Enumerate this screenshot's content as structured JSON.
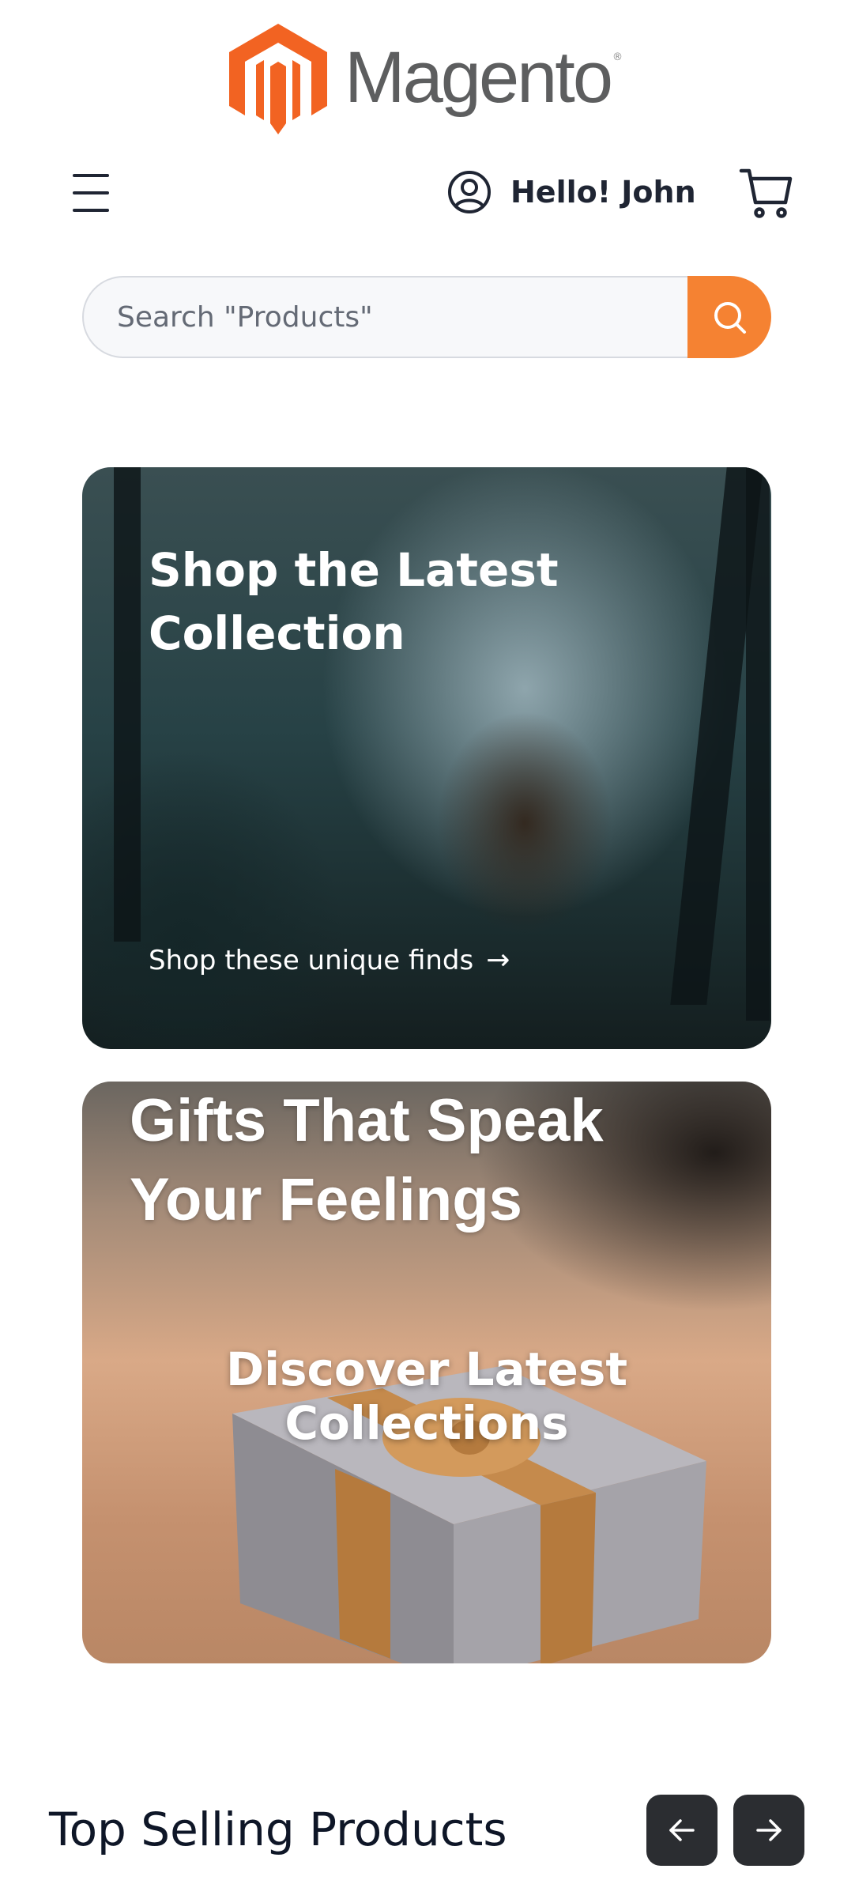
{
  "logo": {
    "name": "Magento",
    "mark": "®",
    "brand_color": "#f26322"
  },
  "header": {
    "menu_icon": "hamburger-icon",
    "user_icon": "user-circle-icon",
    "greeting": "Hello! John",
    "cart_icon": "cart-icon"
  },
  "search": {
    "placeholder": "Search \"Products\"",
    "value": "",
    "button_icon": "search-icon",
    "accent": "#f58232"
  },
  "banners": [
    {
      "title": "Shop the Latest Collection",
      "link_text": "Shop these unique finds",
      "link_icon": "arrow-right-icon"
    },
    {
      "image_text": "Gifts That Speak Your Feelings",
      "title": "Discover Latest Collections"
    }
  ],
  "top_selling": {
    "title": "Top Selling Products",
    "prev_icon": "arrow-left-icon",
    "next_icon": "arrow-right-icon"
  }
}
